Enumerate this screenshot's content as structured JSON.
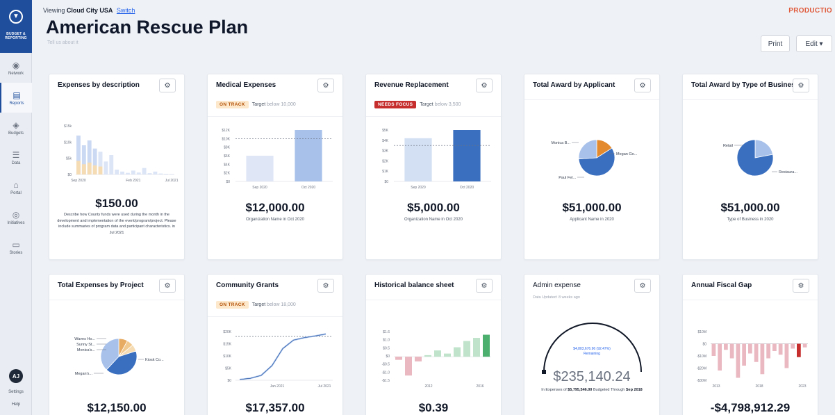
{
  "sidebar": {
    "brand": "BUDGET & REPORTING",
    "items": [
      {
        "label": "Network",
        "icon": "network-icon"
      },
      {
        "label": "Reports",
        "icon": "reports-icon"
      },
      {
        "label": "Budgets",
        "icon": "budgets-icon"
      },
      {
        "label": "Data",
        "icon": "data-icon"
      },
      {
        "label": "Portal",
        "icon": "portal-icon"
      },
      {
        "label": "Initiatives",
        "icon": "initiatives-icon"
      },
      {
        "label": "Stories",
        "icon": "stories-icon"
      }
    ],
    "avatar": "AJ",
    "settings": "Settings",
    "help": "Help"
  },
  "header": {
    "viewing_prefix": "Viewing",
    "org": "Cloud City USA",
    "switch": "Switch",
    "env": "PRODUCTIO",
    "title": "American Rescue Plan",
    "subtitle": "Tell us about it",
    "print": "Print",
    "edit": "Edit ▾"
  },
  "cards": {
    "expenses_desc": {
      "title": "Expenses by description",
      "value": "$150.00",
      "description": "Describe how County funds were used during the month in the development and implementation of the event/program/project. Please include summaries of program data and participant characteristics. in Jul 2021"
    },
    "medical": {
      "title": "Medical Expenses",
      "badge": "ON TRACK",
      "target_label": "Target",
      "target_value": "below 10,000",
      "value": "$12,000.00",
      "caption": "Organization Name in Oct 2020"
    },
    "revenue": {
      "title": "Revenue Replacement",
      "badge": "NEEDS FOCUS",
      "target_label": "Target",
      "target_value": "below 3,500",
      "value": "$5,000.00",
      "caption": "Organization Name in Oct 2020"
    },
    "award_applicant": {
      "title": "Total Award by Applicant",
      "value": "$51,000.00",
      "caption": "Applicant Name in 2020"
    },
    "award_business": {
      "title": "Total Award by Type of Business",
      "value": "$51,000.00",
      "caption": "Type of Business in 2020"
    },
    "expenses_project": {
      "title": "Total Expenses by Project",
      "value": "$12,150.00"
    },
    "community": {
      "title": "Community Grants",
      "badge": "ON TRACK",
      "target_label": "Target",
      "target_value": "below 18,000",
      "value": "$17,357.00"
    },
    "historical": {
      "title": "Historical balance sheet",
      "value": "$0.39"
    },
    "admin": {
      "title": "Admin expense",
      "note": "Data Updated: 8 weeks ago",
      "gauge_inner_1": "$4,803,676.96 (92.47%)",
      "gauge_inner_2": "Remaining",
      "value": "$235,140.24",
      "foot_1": "In Expenses of",
      "foot_amount": "$5,795,546.00",
      "foot_2": "Budgeted Through",
      "foot_end": "Sep 2018"
    },
    "fiscal_gap": {
      "title": "Annual Fiscal Gap",
      "value": "-$4,798,912.29"
    }
  },
  "colors": {
    "accent": "#1f4e9c",
    "light_blue": "#a7c1ea",
    "orange": "#e38a2e",
    "green": "#4caf6e",
    "pink": "#eab8c0",
    "red": "#c62d2d"
  },
  "chart_data": [
    {
      "type": "bar",
      "title": "Expenses by description",
      "categories": [
        "Sep 2020",
        "",
        "",
        "",
        "",
        "",
        "",
        "",
        "",
        "",
        "Feb 2021",
        "",
        "",
        "",
        "",
        "",
        "",
        "Jul 2021"
      ],
      "yticks": [
        "$15k",
        "$10k",
        "$5k",
        "$0"
      ],
      "series": [
        {
          "values": [
            12000,
            9000,
            10500,
            8000,
            7000,
            4000,
            6000,
            1500,
            900,
            500,
            1200,
            600,
            2000,
            400,
            900,
            300,
            200,
            150
          ]
        }
      ]
    },
    {
      "type": "bar",
      "title": "Medical Expenses",
      "categories": [
        "Sep 2020",
        "Oct 2020"
      ],
      "yticks": [
        "$12K",
        "$10K",
        "$8K",
        "$6K",
        "$4K",
        "$2K",
        "$0"
      ],
      "values": [
        6000,
        12000
      ],
      "target": 10000
    },
    {
      "type": "bar",
      "title": "Revenue Replacement",
      "categories": [
        "Sep 2020",
        "Oct 2020"
      ],
      "yticks": [
        "$5K",
        "$4K",
        "$3K",
        "$2K",
        "$1K",
        "$0"
      ],
      "values": [
        4200,
        5000
      ],
      "target": 3500
    },
    {
      "type": "pie",
      "title": "Total Award by Applicant",
      "labels": [
        "Monica B...",
        "Megan Go...",
        "Paul Fel..."
      ],
      "values": [
        16,
        58,
        26
      ]
    },
    {
      "type": "pie",
      "title": "Total Award by Type of Business",
      "labels": [
        "Retail",
        "Restaura..."
      ],
      "values": [
        22,
        78
      ]
    },
    {
      "type": "pie",
      "title": "Total Expenses by Project",
      "labels": [
        "Waves Ho...",
        "Sunny St...",
        "Monica's...",
        "Kiosk Co...",
        "Megan's..."
      ],
      "values": [
        8,
        6,
        6,
        42,
        38
      ]
    },
    {
      "type": "line",
      "title": "Community Grants",
      "xticks": [
        "Jan 2021",
        "Jul 2021"
      ],
      "yticks": [
        "$20K",
        "$15K",
        "$10K",
        "$5K",
        "$0"
      ],
      "target": 18000,
      "values": [
        300,
        800,
        2000,
        6000,
        13000,
        16500,
        17500,
        18200,
        19000
      ]
    },
    {
      "type": "bar",
      "title": "Historical balance sheet",
      "xticks": [
        "2012",
        "2016"
      ],
      "yticks": [
        "$1.6",
        "$1.0",
        "$0.5",
        "$0",
        "-$0.5",
        "-$1.0",
        "-$1.5"
      ],
      "values": [
        -0.2,
        -1.2,
        -0.3,
        0.1,
        0.4,
        0.2,
        0.6,
        1.0,
        1.2,
        1.4
      ]
    },
    {
      "type": "bar",
      "title": "Annual Fiscal Gap",
      "xticks": [
        "2013",
        "2018",
        "2023"
      ],
      "yticks": [
        "$10M",
        "$0",
        "-$10M",
        "-$20M",
        "-$30M"
      ],
      "values": [
        -10,
        -22,
        -5,
        -12,
        -28,
        -18,
        -8,
        -15,
        -25,
        -12,
        -6,
        -9,
        -20,
        -4,
        -11,
        -3
      ]
    }
  ]
}
